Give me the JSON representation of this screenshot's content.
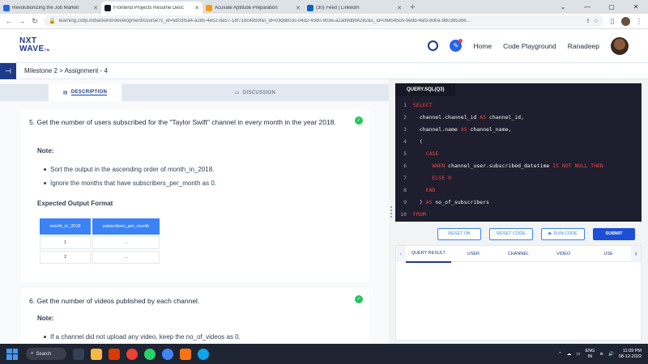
{
  "browser": {
    "tabs": [
      {
        "title": "Revolutionizing the Job Market",
        "color": "#2563eb",
        "active": false
      },
      {
        "title": "Frontend Projects Resume Desc",
        "color": "#111827",
        "active": true
      },
      {
        "title": "Acuvate Aptitude Preparation",
        "color": "#f59e0b",
        "active": false
      },
      {
        "title": "(30) Feed | LinkedIn",
        "color": "#0a66c2",
        "active": false
      }
    ],
    "url": "learning.ccbp.in/backend-development/course?c_id=5d03f5a4-a285-4e52-8a57-18f718c4859f&t_id=03d6b03c-04d2-4580-903e-a2ad9dbb4282&s_id=09454505-9e9d-4af3-8d0a-980385368..."
  },
  "header": {
    "logo_line1": "NXT",
    "logo_line2": "WAVE",
    "logo_tm": "TM",
    "nav_home": "Home",
    "nav_playground": "Code Playground",
    "user_name": "Ranadeep"
  },
  "breadcrumb": "Milestone 2 > Assignment - 4",
  "left_tabs": {
    "description": "DESCRIPTION",
    "discussion": "DISCUSSION"
  },
  "question5": {
    "number": "5.",
    "text": "Get the number of users subscribed for the \"Taylor Swift\" channel in every month in the year 2018.",
    "note_label": "Note:",
    "bullets": [
      "Sort the output in the ascending order of month_in_2018.",
      "Ignore the months that have subscribers_per_month as 0."
    ],
    "expected_label": "Expected Output Format",
    "table": {
      "headers": [
        "month_in_2018",
        "subscribers_per_month"
      ],
      "rows": [
        [
          "1",
          "..."
        ],
        [
          "2",
          "..."
        ]
      ]
    }
  },
  "question6": {
    "number": "6.",
    "text": "Get the number of videos published by each channel.",
    "note_label": "Note:",
    "bullets": [
      "If a channel did not upload any video, keep the no_of_videos as 0."
    ]
  },
  "editor": {
    "tab": "QUERY.SQL(Q3)",
    "lines": [
      {
        "n": "1",
        "parts": [
          {
            "t": "SELECT",
            "k": true
          }
        ]
      },
      {
        "n": "2",
        "parts": [
          {
            "t": "  channel.channel_id ",
            "k": false
          },
          {
            "t": "AS",
            "k": true
          },
          {
            "t": " channel_id,",
            "k": false
          }
        ]
      },
      {
        "n": "3",
        "parts": [
          {
            "t": "  channel.name ",
            "k": false
          },
          {
            "t": "AS",
            "k": true
          },
          {
            "t": " channel_name,",
            "k": false
          }
        ]
      },
      {
        "n": "4",
        "parts": [
          {
            "t": "  (",
            "k": false
          }
        ]
      },
      {
        "n": "5",
        "parts": [
          {
            "t": "    ",
            "k": false
          },
          {
            "t": "CASE",
            "k": true
          }
        ]
      },
      {
        "n": "6",
        "parts": [
          {
            "t": "      ",
            "k": false
          },
          {
            "t": "WHEN",
            "k": true
          },
          {
            "t": " channel_user.subscribed_datetime ",
            "k": false
          },
          {
            "t": "IS NOT NULL THEN",
            "k": true
          }
        ]
      },
      {
        "n": "7",
        "parts": [
          {
            "t": "      ",
            "k": false
          },
          {
            "t": "ELSE",
            "k": true
          },
          {
            "t": " ",
            "k": false
          },
          {
            "t": "0",
            "k": true
          }
        ]
      },
      {
        "n": "8",
        "parts": [
          {
            "t": "    ",
            "k": false
          },
          {
            "t": "END",
            "k": true
          }
        ]
      },
      {
        "n": "9",
        "parts": [
          {
            "t": "  ) ",
            "k": false
          },
          {
            "t": "AS",
            "k": true
          },
          {
            "t": " no_of_subscribers",
            "k": false
          }
        ]
      },
      {
        "n": "10",
        "parts": [
          {
            "t": "FROM",
            "k": true
          }
        ]
      }
    ]
  },
  "buttons": {
    "reset_db": "RESET DB",
    "reset_code": "RESET CODE",
    "run_code": "RUN CODE",
    "submit": "SUBMIT"
  },
  "result_tabs": [
    "QUERY RESULT",
    "USER",
    "CHANNEL",
    "VIDEO",
    "USE"
  ],
  "taskbar": {
    "search": "Search",
    "lang_line1": "ENG",
    "lang_line2": "IN",
    "time": "11:09 PM",
    "date": "08-12-2022"
  }
}
